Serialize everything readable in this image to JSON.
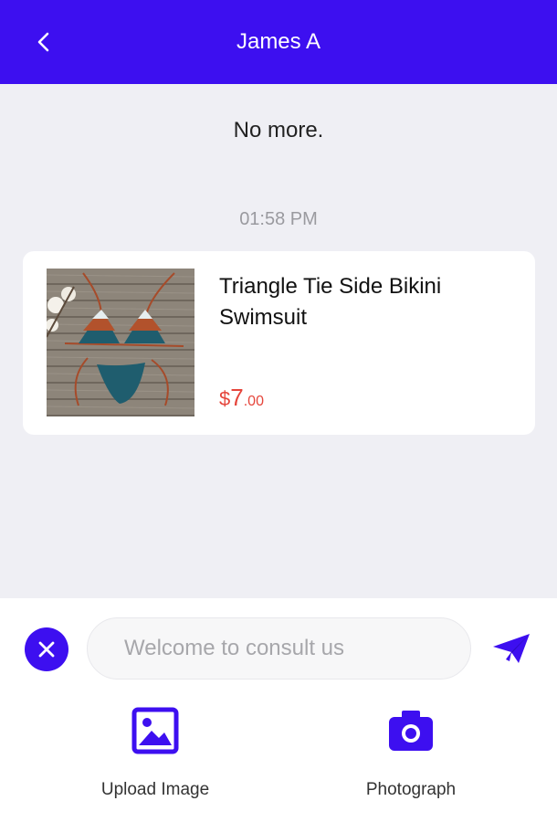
{
  "header": {
    "title": "James A",
    "back_icon": "chevron-left-icon"
  },
  "conversation": {
    "no_more_text": "No more.",
    "timestamp": "01:58 PM"
  },
  "product": {
    "name": "Triangle Tie Side Bikini Swimsuit",
    "price_currency": "$",
    "price_integer": "7",
    "price_decimal": ".00",
    "price_color": "#e5453b"
  },
  "composer": {
    "placeholder": "Welcome to consult us",
    "value": "",
    "close_icon": "close-icon",
    "send_icon": "send-icon"
  },
  "actions": [
    {
      "label": "Upload Image",
      "icon": "image-icon"
    },
    {
      "label": "Photograph",
      "icon": "camera-icon"
    }
  ],
  "colors": {
    "accent": "#3d0ff0",
    "background": "#efeff4",
    "price": "#e5453b"
  }
}
